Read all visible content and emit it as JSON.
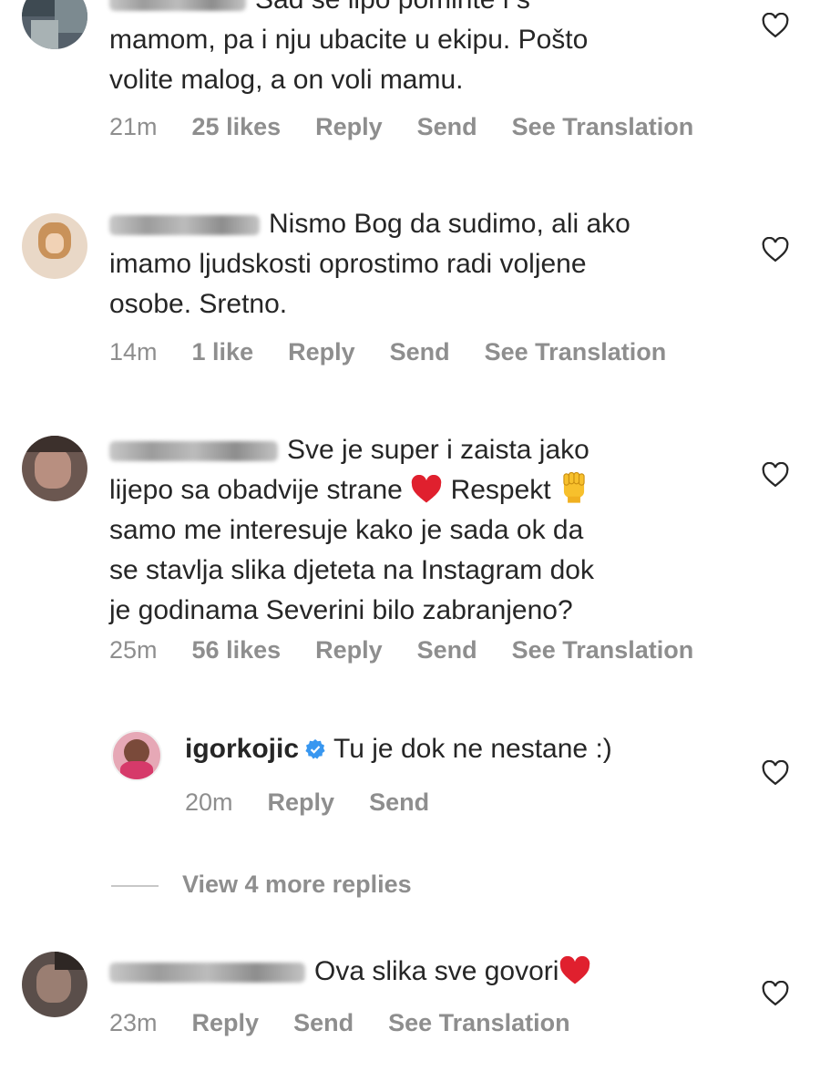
{
  "comments": [
    {
      "text_lines": [
        "Sad se lipo pominte i s",
        "mamom,  pa i nju ubacite u ekipu. Pošto",
        "volite malog, a on voli mamu."
      ],
      "time": "21m",
      "likes": "25 likes",
      "reply": "Reply",
      "send": "Send",
      "translate": "See Translation"
    },
    {
      "text_lines": [
        "Nismo Bog da sudimo, ali ako",
        "imamo ljudskosti oprostimo radi voljene",
        "osobe. Sretno."
      ],
      "time": "14m",
      "likes": "1 like",
      "reply": "Reply",
      "send": "Send",
      "translate": "See Translation"
    },
    {
      "text_line1": "Sve je super i zaista jako",
      "text_line2a": "lijepo sa obadvije strane",
      "text_line2b": "Respekt",
      "text_lines_rest": [
        "samo me interesuje kako je sada ok da",
        "se stavlja slika djeteta na Instagram dok",
        "je godinama Severini bilo zabranjeno?"
      ],
      "time": "25m",
      "likes": "56 likes",
      "reply": "Reply",
      "send": "Send",
      "translate": "See Translation"
    },
    {
      "username": "igorkojic",
      "text": "Tu je dok ne nestane :)",
      "time": "20m",
      "reply": "Reply",
      "send": "Send"
    },
    {
      "text": "Ova slika sve govori",
      "time": "23m",
      "reply": "Reply",
      "send": "Send",
      "translate": "See Translation"
    }
  ],
  "view_more": "View 4 more replies",
  "colors": {
    "text": "#262626",
    "meta": "#8e8e8e",
    "heart_emoji": "#e0202e",
    "verified": "#3897f0"
  }
}
